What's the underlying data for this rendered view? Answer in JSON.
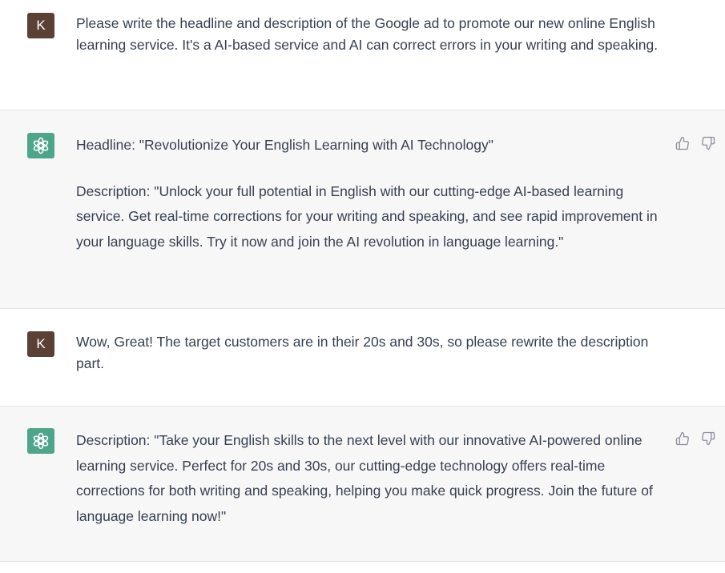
{
  "conversation": {
    "messages": [
      {
        "role": "user",
        "avatar_letter": "K",
        "text": "Please write the headline and description of the Google ad to promote our new online English learning service. It's a AI-based service and AI can correct errors in your writing and speaking."
      },
      {
        "role": "assistant",
        "headline": "Headline: \"Revolutionize Your English Learning with AI Technology\"",
        "description": "Description: \"Unlock your full potential in English with our cutting-edge AI-based learning service. Get real-time corrections for your writing and speaking, and see rapid improvement in your language skills. Try it now and join the AI revolution in language learning.\""
      },
      {
        "role": "user",
        "avatar_letter": "K",
        "text": "Wow, Great! The target customers are in their 20s and 30s, so please rewrite the description part."
      },
      {
        "role": "assistant",
        "description": "Description: \"Take your English skills to the next level with our innovative AI-powered online learning service. Perfect for 20s and 30s, our cutting-edge technology offers real-time corrections for both writing and speaking, helping you make quick progress. Join the future of language learning now!\""
      }
    ]
  },
  "icons": {
    "user_avatar": "letter-avatar",
    "assistant_avatar": "openai-logo-icon",
    "like": "thumbs-up-icon",
    "dislike": "thumbs-down-icon"
  },
  "colors": {
    "user_avatar_bg": "#5b4036",
    "assistant_avatar_bg": "#4fa58a",
    "assistant_row_bg": "#f7f7f8"
  }
}
